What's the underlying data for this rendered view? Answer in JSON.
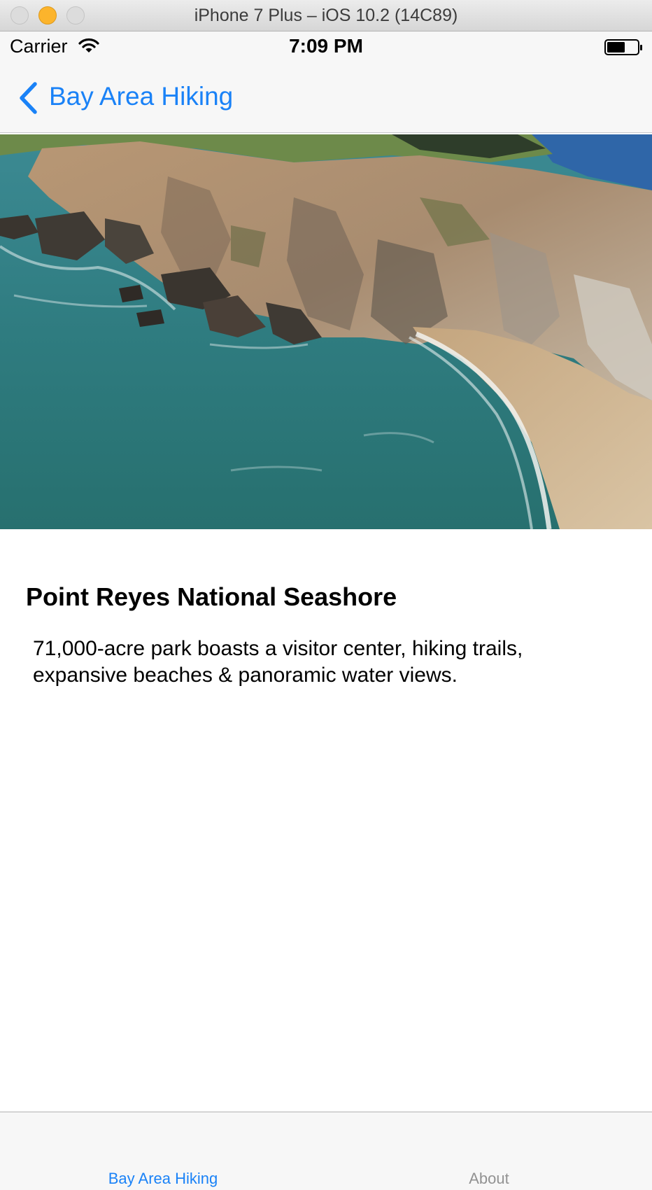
{
  "window": {
    "title": "iPhone 7 Plus – iOS 10.2 (14C89)"
  },
  "status_bar": {
    "carrier": "Carrier",
    "time": "7:09 PM",
    "wifi_icon": "wifi-icon",
    "battery_icon": "battery-icon",
    "battery_level": 0.6
  },
  "nav": {
    "back_label": "Bay Area Hiking",
    "back_icon": "chevron-left-icon"
  },
  "hero": {
    "image_description_icon": "coastal-photo"
  },
  "park": {
    "title": "Point Reyes National Seashore",
    "description": "71,000-acre park boasts a visitor center, hiking trails, expansive beaches & panoramic water views."
  },
  "tabbar": {
    "tabs": [
      {
        "label": "Bay Area Hiking",
        "selected": true
      },
      {
        "label": "About",
        "selected": false
      }
    ]
  },
  "colors": {
    "tint": "#1a82f7",
    "inactive_tab": "#929292",
    "bar_background": "#f7f7f7"
  }
}
